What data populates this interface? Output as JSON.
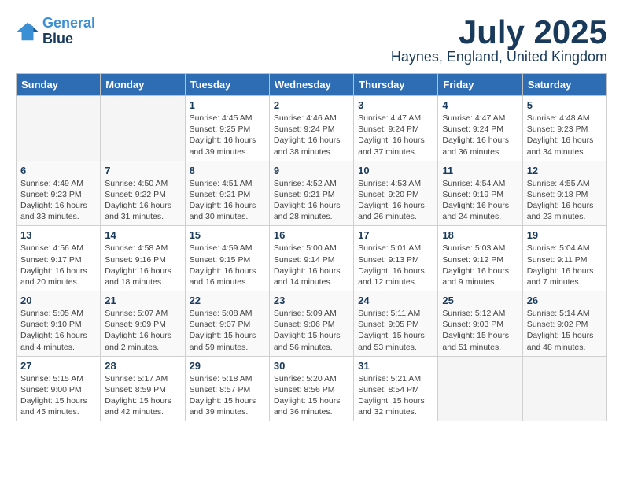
{
  "header": {
    "logo_line1": "General",
    "logo_line2": "Blue",
    "month_title": "July 2025",
    "location": "Haynes, England, United Kingdom"
  },
  "days_of_week": [
    "Sunday",
    "Monday",
    "Tuesday",
    "Wednesday",
    "Thursday",
    "Friday",
    "Saturday"
  ],
  "weeks": [
    [
      {
        "day": "",
        "empty": true
      },
      {
        "day": "",
        "empty": true
      },
      {
        "day": "1",
        "sunrise": "Sunrise: 4:45 AM",
        "sunset": "Sunset: 9:25 PM",
        "daylight": "Daylight: 16 hours and 39 minutes."
      },
      {
        "day": "2",
        "sunrise": "Sunrise: 4:46 AM",
        "sunset": "Sunset: 9:24 PM",
        "daylight": "Daylight: 16 hours and 38 minutes."
      },
      {
        "day": "3",
        "sunrise": "Sunrise: 4:47 AM",
        "sunset": "Sunset: 9:24 PM",
        "daylight": "Daylight: 16 hours and 37 minutes."
      },
      {
        "day": "4",
        "sunrise": "Sunrise: 4:47 AM",
        "sunset": "Sunset: 9:24 PM",
        "daylight": "Daylight: 16 hours and 36 minutes."
      },
      {
        "day": "5",
        "sunrise": "Sunrise: 4:48 AM",
        "sunset": "Sunset: 9:23 PM",
        "daylight": "Daylight: 16 hours and 34 minutes."
      }
    ],
    [
      {
        "day": "6",
        "sunrise": "Sunrise: 4:49 AM",
        "sunset": "Sunset: 9:23 PM",
        "daylight": "Daylight: 16 hours and 33 minutes."
      },
      {
        "day": "7",
        "sunrise": "Sunrise: 4:50 AM",
        "sunset": "Sunset: 9:22 PM",
        "daylight": "Daylight: 16 hours and 31 minutes."
      },
      {
        "day": "8",
        "sunrise": "Sunrise: 4:51 AM",
        "sunset": "Sunset: 9:21 PM",
        "daylight": "Daylight: 16 hours and 30 minutes."
      },
      {
        "day": "9",
        "sunrise": "Sunrise: 4:52 AM",
        "sunset": "Sunset: 9:21 PM",
        "daylight": "Daylight: 16 hours and 28 minutes."
      },
      {
        "day": "10",
        "sunrise": "Sunrise: 4:53 AM",
        "sunset": "Sunset: 9:20 PM",
        "daylight": "Daylight: 16 hours and 26 minutes."
      },
      {
        "day": "11",
        "sunrise": "Sunrise: 4:54 AM",
        "sunset": "Sunset: 9:19 PM",
        "daylight": "Daylight: 16 hours and 24 minutes."
      },
      {
        "day": "12",
        "sunrise": "Sunrise: 4:55 AM",
        "sunset": "Sunset: 9:18 PM",
        "daylight": "Daylight: 16 hours and 23 minutes."
      }
    ],
    [
      {
        "day": "13",
        "sunrise": "Sunrise: 4:56 AM",
        "sunset": "Sunset: 9:17 PM",
        "daylight": "Daylight: 16 hours and 20 minutes."
      },
      {
        "day": "14",
        "sunrise": "Sunrise: 4:58 AM",
        "sunset": "Sunset: 9:16 PM",
        "daylight": "Daylight: 16 hours and 18 minutes."
      },
      {
        "day": "15",
        "sunrise": "Sunrise: 4:59 AM",
        "sunset": "Sunset: 9:15 PM",
        "daylight": "Daylight: 16 hours and 16 minutes."
      },
      {
        "day": "16",
        "sunrise": "Sunrise: 5:00 AM",
        "sunset": "Sunset: 9:14 PM",
        "daylight": "Daylight: 16 hours and 14 minutes."
      },
      {
        "day": "17",
        "sunrise": "Sunrise: 5:01 AM",
        "sunset": "Sunset: 9:13 PM",
        "daylight": "Daylight: 16 hours and 12 minutes."
      },
      {
        "day": "18",
        "sunrise": "Sunrise: 5:03 AM",
        "sunset": "Sunset: 9:12 PM",
        "daylight": "Daylight: 16 hours and 9 minutes."
      },
      {
        "day": "19",
        "sunrise": "Sunrise: 5:04 AM",
        "sunset": "Sunset: 9:11 PM",
        "daylight": "Daylight: 16 hours and 7 minutes."
      }
    ],
    [
      {
        "day": "20",
        "sunrise": "Sunrise: 5:05 AM",
        "sunset": "Sunset: 9:10 PM",
        "daylight": "Daylight: 16 hours and 4 minutes."
      },
      {
        "day": "21",
        "sunrise": "Sunrise: 5:07 AM",
        "sunset": "Sunset: 9:09 PM",
        "daylight": "Daylight: 16 hours and 2 minutes."
      },
      {
        "day": "22",
        "sunrise": "Sunrise: 5:08 AM",
        "sunset": "Sunset: 9:07 PM",
        "daylight": "Daylight: 15 hours and 59 minutes."
      },
      {
        "day": "23",
        "sunrise": "Sunrise: 5:09 AM",
        "sunset": "Sunset: 9:06 PM",
        "daylight": "Daylight: 15 hours and 56 minutes."
      },
      {
        "day": "24",
        "sunrise": "Sunrise: 5:11 AM",
        "sunset": "Sunset: 9:05 PM",
        "daylight": "Daylight: 15 hours and 53 minutes."
      },
      {
        "day": "25",
        "sunrise": "Sunrise: 5:12 AM",
        "sunset": "Sunset: 9:03 PM",
        "daylight": "Daylight: 15 hours and 51 minutes."
      },
      {
        "day": "26",
        "sunrise": "Sunrise: 5:14 AM",
        "sunset": "Sunset: 9:02 PM",
        "daylight": "Daylight: 15 hours and 48 minutes."
      }
    ],
    [
      {
        "day": "27",
        "sunrise": "Sunrise: 5:15 AM",
        "sunset": "Sunset: 9:00 PM",
        "daylight": "Daylight: 15 hours and 45 minutes."
      },
      {
        "day": "28",
        "sunrise": "Sunrise: 5:17 AM",
        "sunset": "Sunset: 8:59 PM",
        "daylight": "Daylight: 15 hours and 42 minutes."
      },
      {
        "day": "29",
        "sunrise": "Sunrise: 5:18 AM",
        "sunset": "Sunset: 8:57 PM",
        "daylight": "Daylight: 15 hours and 39 minutes."
      },
      {
        "day": "30",
        "sunrise": "Sunrise: 5:20 AM",
        "sunset": "Sunset: 8:56 PM",
        "daylight": "Daylight: 15 hours and 36 minutes."
      },
      {
        "day": "31",
        "sunrise": "Sunrise: 5:21 AM",
        "sunset": "Sunset: 8:54 PM",
        "daylight": "Daylight: 15 hours and 32 minutes."
      },
      {
        "day": "",
        "empty": true
      },
      {
        "day": "",
        "empty": true
      }
    ]
  ]
}
